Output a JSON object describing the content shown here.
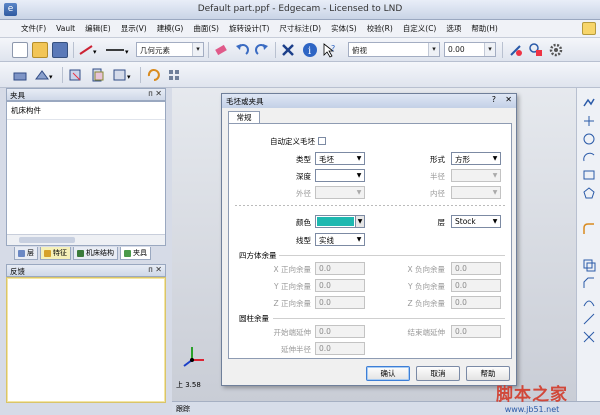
{
  "window": {
    "title": "Default part.ppf - Edgecam - Licensed to LND"
  },
  "menu": [
    "文件(F)",
    "Vault",
    "编辑(E)",
    "显示(V)",
    "建模(G)",
    "曲面(S)",
    "旋转设计(T)",
    "尺寸标注(D)",
    "实体(S)",
    "校验(R)",
    "自定义(C)",
    "选项",
    "帮助(H)"
  ],
  "toolbar1": {
    "entity_select": "几何元素",
    "view_select": "俯视",
    "value_select": "0.00"
  },
  "panels": {
    "top": {
      "title": "夹具",
      "item": "机床构件",
      "tabs": [
        "层",
        "特征",
        "机床结构",
        "夹具"
      ]
    },
    "bottom": {
      "title": "反馈"
    }
  },
  "status": {
    "coord": "上 3.58",
    "bottom_label": "跟踪"
  },
  "dialog": {
    "title": "毛坯或夹具",
    "tab": "常规",
    "auto_define_label": "自动定义毛坯",
    "type_label": "类型",
    "type_value": "毛坯",
    "shape_label": "形式",
    "shape_value": "方形",
    "depth_label": "深度",
    "depth_value": "",
    "radius_label": "半径",
    "radius_value": "",
    "outer_label": "外径",
    "outer_value": "",
    "inner_label": "内径",
    "inner_value": "",
    "color_label": "颜色",
    "layer_label": "层",
    "layer_value": "Stock",
    "linetype_label": "线型",
    "linetype_value": "实线",
    "cube_group": "四方体余量",
    "x_pos_label": "X 正向余量",
    "x_pos": "0.0",
    "x_neg_label": "X 负向余量",
    "x_neg": "0.0",
    "y_pos_label": "Y 正向余量",
    "y_pos": "0.0",
    "y_neg_label": "Y 负向余量",
    "y_neg": "0.0",
    "z_pos_label": "Z 正向余量",
    "z_pos": "0.0",
    "z_neg_label": "Z 负向余量",
    "z_neg": "0.0",
    "cyl_group": "圆柱余量",
    "start_ext_label": "开始端延伸",
    "start_ext": "0.0",
    "end_ext_label": "结束端延伸",
    "end_ext": "0.0",
    "ext_radius_label": "延伸半径",
    "ext_radius": "0.0",
    "ok": "确认",
    "cancel": "取消",
    "help": "帮助"
  },
  "colors": {
    "stock_color": "#1eb8b0"
  },
  "watermark": {
    "big": "脚本之家",
    "small": "www.jb51.net"
  }
}
